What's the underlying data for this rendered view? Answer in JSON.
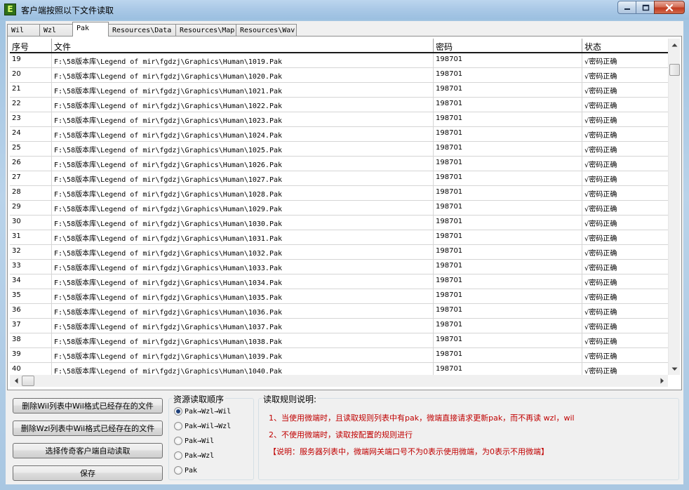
{
  "window": {
    "title": "客户端按照以下文件读取",
    "app_icon_letter": "E"
  },
  "tabs": [
    {
      "label": "Wil",
      "active": false
    },
    {
      "label": "Wzl",
      "active": false
    },
    {
      "label": "Pak",
      "active": true
    },
    {
      "label": "Resources\\Data",
      "active": false
    },
    {
      "label": "Resources\\Map",
      "active": false
    },
    {
      "label": "Resources\\Wav",
      "active": false
    }
  ],
  "table": {
    "columns": [
      "序号",
      "文件",
      "密码",
      "状态"
    ],
    "rows": [
      {
        "index": "19",
        "file": "F:\\58版本库\\Legend of mir\\fgdzj\\Graphics\\Human\\1019.Pak",
        "password": "198701",
        "status": "√密码正确"
      },
      {
        "index": "20",
        "file": "F:\\58版本库\\Legend of mir\\fgdzj\\Graphics\\Human\\1020.Pak",
        "password": "198701",
        "status": "√密码正确"
      },
      {
        "index": "21",
        "file": "F:\\58版本库\\Legend of mir\\fgdzj\\Graphics\\Human\\1021.Pak",
        "password": "198701",
        "status": "√密码正确"
      },
      {
        "index": "22",
        "file": "F:\\58版本库\\Legend of mir\\fgdzj\\Graphics\\Human\\1022.Pak",
        "password": "198701",
        "status": "√密码正确"
      },
      {
        "index": "23",
        "file": "F:\\58版本库\\Legend of mir\\fgdzj\\Graphics\\Human\\1023.Pak",
        "password": "198701",
        "status": "√密码正确"
      },
      {
        "index": "24",
        "file": "F:\\58版本库\\Legend of mir\\fgdzj\\Graphics\\Human\\1024.Pak",
        "password": "198701",
        "status": "√密码正确"
      },
      {
        "index": "25",
        "file": "F:\\58版本库\\Legend of mir\\fgdzj\\Graphics\\Human\\1025.Pak",
        "password": "198701",
        "status": "√密码正确"
      },
      {
        "index": "26",
        "file": "F:\\58版本库\\Legend of mir\\fgdzj\\Graphics\\Human\\1026.Pak",
        "password": "198701",
        "status": "√密码正确"
      },
      {
        "index": "27",
        "file": "F:\\58版本库\\Legend of mir\\fgdzj\\Graphics\\Human\\1027.Pak",
        "password": "198701",
        "status": "√密码正确"
      },
      {
        "index": "28",
        "file": "F:\\58版本库\\Legend of mir\\fgdzj\\Graphics\\Human\\1028.Pak",
        "password": "198701",
        "status": "√密码正确"
      },
      {
        "index": "29",
        "file": "F:\\58版本库\\Legend of mir\\fgdzj\\Graphics\\Human\\1029.Pak",
        "password": "198701",
        "status": "√密码正确"
      },
      {
        "index": "30",
        "file": "F:\\58版本库\\Legend of mir\\fgdzj\\Graphics\\Human\\1030.Pak",
        "password": "198701",
        "status": "√密码正确"
      },
      {
        "index": "31",
        "file": "F:\\58版本库\\Legend of mir\\fgdzj\\Graphics\\Human\\1031.Pak",
        "password": "198701",
        "status": "√密码正确"
      },
      {
        "index": "32",
        "file": "F:\\58版本库\\Legend of mir\\fgdzj\\Graphics\\Human\\1032.Pak",
        "password": "198701",
        "status": "√密码正确"
      },
      {
        "index": "33",
        "file": "F:\\58版本库\\Legend of mir\\fgdzj\\Graphics\\Human\\1033.Pak",
        "password": "198701",
        "status": "√密码正确"
      },
      {
        "index": "34",
        "file": "F:\\58版本库\\Legend of mir\\fgdzj\\Graphics\\Human\\1034.Pak",
        "password": "198701",
        "status": "√密码正确"
      },
      {
        "index": "35",
        "file": "F:\\58版本库\\Legend of mir\\fgdzj\\Graphics\\Human\\1035.Pak",
        "password": "198701",
        "status": "√密码正确"
      },
      {
        "index": "36",
        "file": "F:\\58版本库\\Legend of mir\\fgdzj\\Graphics\\Human\\1036.Pak",
        "password": "198701",
        "status": "√密码正确"
      },
      {
        "index": "37",
        "file": "F:\\58版本库\\Legend of mir\\fgdzj\\Graphics\\Human\\1037.Pak",
        "password": "198701",
        "status": "√密码正确"
      },
      {
        "index": "38",
        "file": "F:\\58版本库\\Legend of mir\\fgdzj\\Graphics\\Human\\1038.Pak",
        "password": "198701",
        "status": "√密码正确"
      },
      {
        "index": "39",
        "file": "F:\\58版本库\\Legend of mir\\fgdzj\\Graphics\\Human\\1039.Pak",
        "password": "198701",
        "status": "√密码正确"
      },
      {
        "index": "40",
        "file": "F:\\58版本库\\Legend of mir\\fgdzj\\Graphics\\Human\\1040.Pak",
        "password": "198701",
        "status": "√密码正确"
      }
    ]
  },
  "actions": {
    "delete_wil_button": "删除Wil列表中Wil格式已经存在的文件",
    "delete_wzl_button": "删除Wzl列表中Wil格式已经存在的文件",
    "auto_read_button": "选择传奇客户端自动读取",
    "save_button": "保存"
  },
  "order_group": {
    "title": "资源读取顺序",
    "options": [
      {
        "label": "Pak→Wzl→Wil",
        "selected": true
      },
      {
        "label": "Pak→Wil→Wzl",
        "selected": false
      },
      {
        "label": "Pak→Wil",
        "selected": false
      },
      {
        "label": "Pak→Wzl",
        "selected": false
      },
      {
        "label": "Pak",
        "selected": false
      }
    ]
  },
  "rules_group": {
    "title": "读取规则说明:",
    "lines": [
      "1、当使用微端时，且读取规则列表中有pak，微端直接请求更新pak，而不再读 wzl，wil",
      "2、不使用微端时，读取按配置的规则进行",
      "【说明：服务器列表中，微端网关端口号不为0表示使用微端，为0表示不用微端】"
    ],
    "text_color": "#c00000"
  },
  "icons": {
    "minimize": "minimize-icon",
    "maximize": "maximize-icon",
    "close": "close-icon"
  }
}
